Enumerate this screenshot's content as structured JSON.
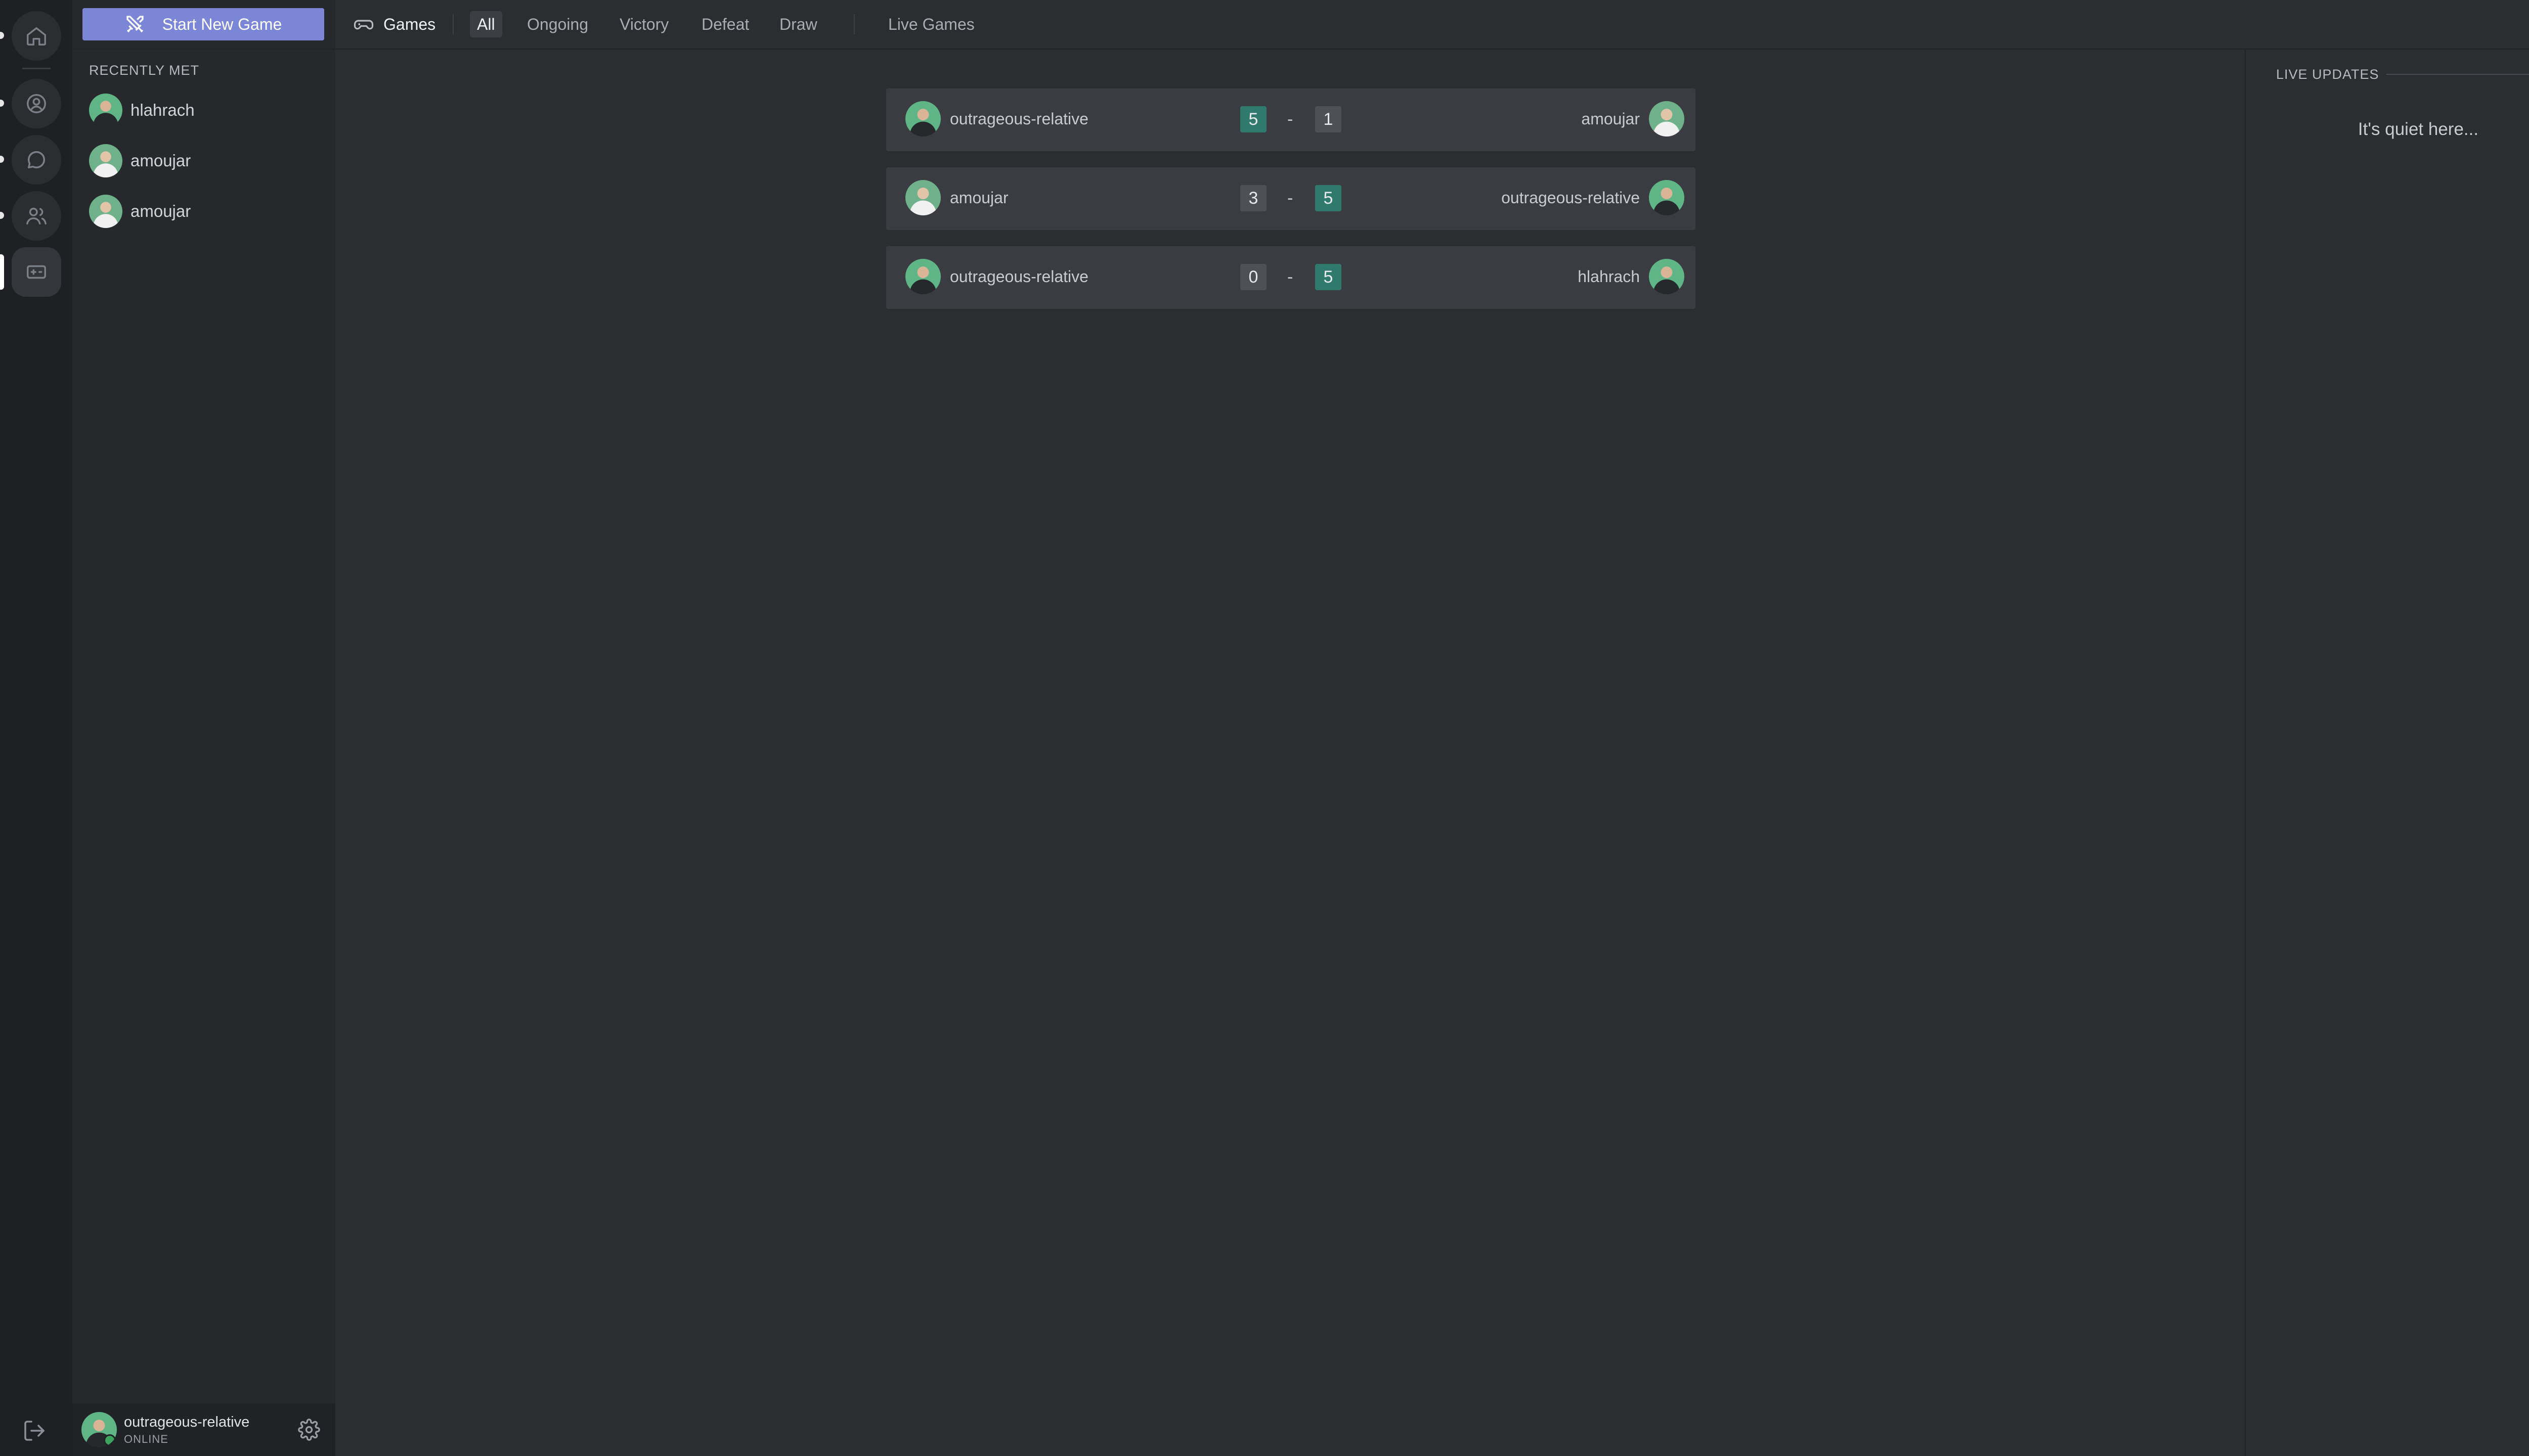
{
  "rail": {
    "icons": [
      "home-icon",
      "profile-icon",
      "chat-icon",
      "friends-icon",
      "games-icon"
    ],
    "logout_icon": "logout-icon"
  },
  "topbar": {
    "new_game_label": "Start New Game",
    "games_label": "Games",
    "filters": [
      "All",
      "Ongoing",
      "Victory",
      "Defeat",
      "Draw"
    ],
    "active_filter": "All",
    "live_games_label": "Live Games"
  },
  "sidebar": {
    "section_title": "RECENTLY MET",
    "friends": [
      {
        "name": "hlahrach"
      },
      {
        "name": "amoujar"
      },
      {
        "name": "amoujar"
      }
    ]
  },
  "user": {
    "name": "outrageous-relative",
    "status": "ONLINE"
  },
  "matches": [
    {
      "left_player": "outrageous-relative",
      "left_score": "5",
      "right_score": "1",
      "right_player": "amoujar",
      "winner": "left"
    },
    {
      "left_player": "amoujar",
      "left_score": "3",
      "right_score": "5",
      "right_player": "outrageous-relative",
      "winner": "right"
    },
    {
      "left_player": "outrageous-relative",
      "left_score": "0",
      "right_score": "5",
      "right_player": "hlahrach",
      "winner": "right"
    }
  ],
  "live_updates": {
    "title": "LIVE UPDATES",
    "empty_message": "It's quiet here..."
  },
  "colors": {
    "accent": "#7b86d6",
    "win_badge": "#2f7a6d",
    "online": "#3ba55d"
  }
}
